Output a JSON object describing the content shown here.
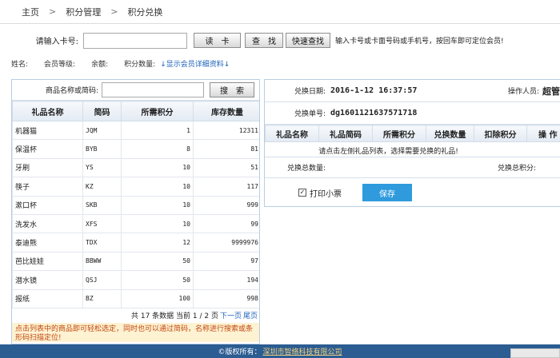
{
  "breadcrumb": {
    "home": "主页",
    "sep": ">",
    "level1": "积分管理",
    "level2": "积分兑换"
  },
  "card_search": {
    "label": "请输入卡号:",
    "value": "",
    "read_card_btn": "读　卡",
    "find_btn": "查　找",
    "quick_find_btn": "快速查找",
    "hint": "输入卡号或卡面号码或手机号，按回车即可定位会员!"
  },
  "member_info": {
    "name_label": "姓名:",
    "level_label": "会员等级:",
    "balance_label": "余额:",
    "points_label": "积分数量:",
    "detail_link": "↓显示会员详细资料↓"
  },
  "gift_search": {
    "label": "商品名称或简码:",
    "value": "",
    "search_btn": "搜　索"
  },
  "gift_table": {
    "headers": [
      "礼品名称",
      "简码",
      "所需积分",
      "库存数量"
    ],
    "rows": [
      {
        "name": "机器猫",
        "code": "JQM",
        "points": "1",
        "stock": "12311"
      },
      {
        "name": "保温杯",
        "code": "BYB",
        "points": "8",
        "stock": "81"
      },
      {
        "name": "牙刷",
        "code": "YS",
        "points": "10",
        "stock": "51"
      },
      {
        "name": "筷子",
        "code": "KZ",
        "points": "10",
        "stock": "117"
      },
      {
        "name": "漱口杯",
        "code": "SKB",
        "points": "10",
        "stock": "999"
      },
      {
        "name": "洗发水",
        "code": "XFS",
        "points": "10",
        "stock": "99"
      },
      {
        "name": "泰迪熊",
        "code": "TDX",
        "points": "12",
        "stock": "9999976"
      },
      {
        "name": "芭比娃娃",
        "code": "BBWW",
        "points": "50",
        "stock": "97"
      },
      {
        "name": "潜水镜",
        "code": "QSJ",
        "points": "50",
        "stock": "194"
      },
      {
        "name": "报纸",
        "code": "BZ",
        "points": "100",
        "stock": "998"
      }
    ]
  },
  "pager": {
    "summary": "共 17 条数据 当前 1 / 2 页",
    "next": "下一页",
    "last": "尾页"
  },
  "tip": "点击列表中的商品即可轻松选定，同时也可以通过简码，名称进行搜索或条形码扫描定位!",
  "exchange": {
    "date_label": "兑换日期:",
    "date_value": "2016-1-12 16:37:57",
    "operator_label": "操作人员:",
    "operator_value": "超管",
    "order_label": "兑换单号:",
    "order_value": "dg1601121637571718",
    "headers": [
      "礼品名称",
      "礼品简码",
      "所需积分",
      "兑换数量",
      "扣除积分",
      "操 作"
    ],
    "empty_msg": "请点击左侧礼品列表，选择需要兑换的礼品!",
    "total_qty_label": "兑换总数量:",
    "total_points_label": "兑换总积分:",
    "print_label": "打印小票",
    "print_checked": true,
    "save_btn": "保存"
  },
  "footer": {
    "prefix": "©版权所有：",
    "company": "深圳市智络科技有限公司"
  },
  "colors": {
    "footer_bg": "#2b5c92",
    "save_btn": "#2f9bdd",
    "link": "#1c62b9",
    "tip_text": "#c4470e"
  }
}
